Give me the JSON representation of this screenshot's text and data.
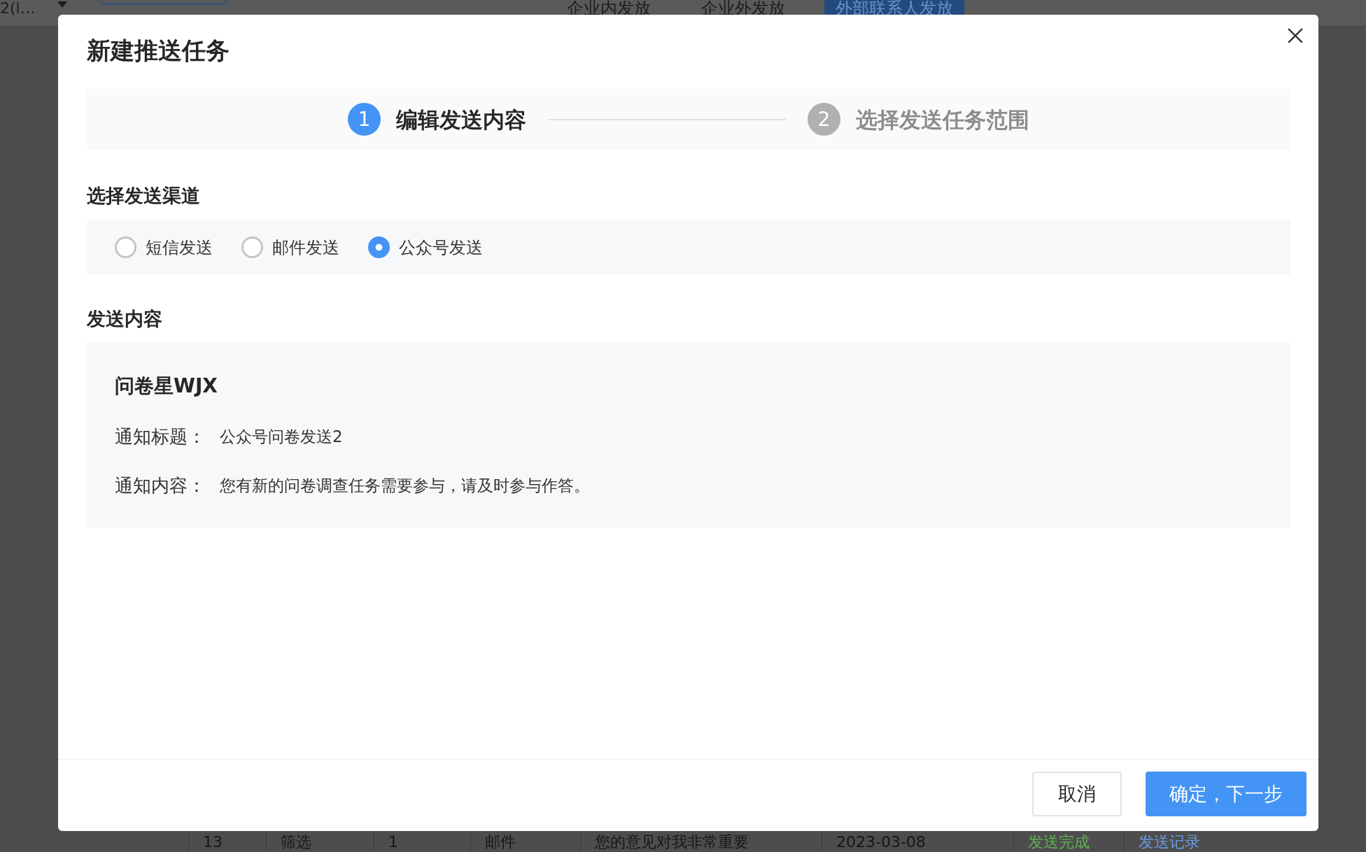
{
  "background": {
    "select_value": "2(l…",
    "tabs": [
      {
        "label": "企业内发放",
        "selected": false
      },
      {
        "label": "企业外发放",
        "selected": false
      },
      {
        "label": "外部联系人发放",
        "selected": true
      }
    ],
    "table_row": [
      {
        "text": "13",
        "kind": "text"
      },
      {
        "text": "筛选",
        "kind": "text"
      },
      {
        "text": "1",
        "kind": "text"
      },
      {
        "text": "邮件",
        "kind": "text"
      },
      {
        "text": "您的意见对我非常重要",
        "kind": "text"
      },
      {
        "text": "2023-03-08",
        "kind": "text"
      },
      {
        "text": "发送完成",
        "kind": "status"
      },
      {
        "text": "发送记录",
        "kind": "link"
      }
    ]
  },
  "dialog": {
    "title": "新建推送任务",
    "steps": [
      {
        "number": "1",
        "label": "编辑发送内容",
        "selected": true
      },
      {
        "number": "2",
        "label": "选择发送任务范围",
        "selected": false
      }
    ],
    "channel_section": {
      "heading": "选择发送渠道",
      "options": [
        {
          "label": "短信发送",
          "selected": false
        },
        {
          "label": "邮件发送",
          "selected": false
        },
        {
          "label": "公众号发送",
          "selected": true
        }
      ]
    },
    "content_section": {
      "heading": "发送内容",
      "account": "问卷星WJX",
      "fields": [
        {
          "label": "通知标题：",
          "value": "公众号问卷发送2"
        },
        {
          "label": "通知内容：",
          "value": "您有新的问卷调查任务需要参与，请及时参与作答。"
        }
      ]
    },
    "buttons": [
      {
        "label": "取消",
        "kind": "secondary"
      },
      {
        "label": "确定，下一步",
        "kind": "primary"
      }
    ]
  }
}
